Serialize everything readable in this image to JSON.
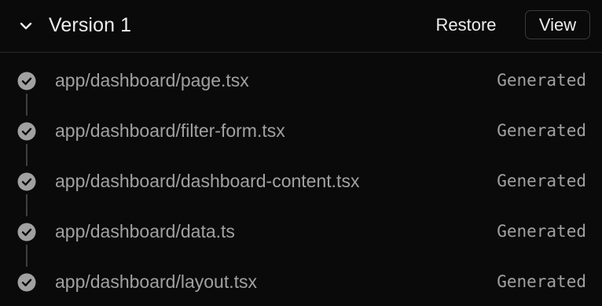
{
  "version": {
    "title": "Version 1",
    "restore_label": "Restore",
    "view_label": "View",
    "expand_icon": "chevron-down-icon"
  },
  "files": [
    {
      "path": "app/dashboard/page.tsx",
      "status": "Generated"
    },
    {
      "path": "app/dashboard/filter-form.tsx",
      "status": "Generated"
    },
    {
      "path": "app/dashboard/dashboard-content.tsx",
      "status": "Generated"
    },
    {
      "path": "app/dashboard/data.ts",
      "status": "Generated"
    },
    {
      "path": "app/dashboard/layout.tsx",
      "status": "Generated"
    }
  ],
  "colors": {
    "background": "#0a0a0a",
    "text_primary": "#ededed",
    "text_secondary": "#a1a1a1",
    "check_fill": "#a1a1a1",
    "border": "#2a2a2a"
  }
}
